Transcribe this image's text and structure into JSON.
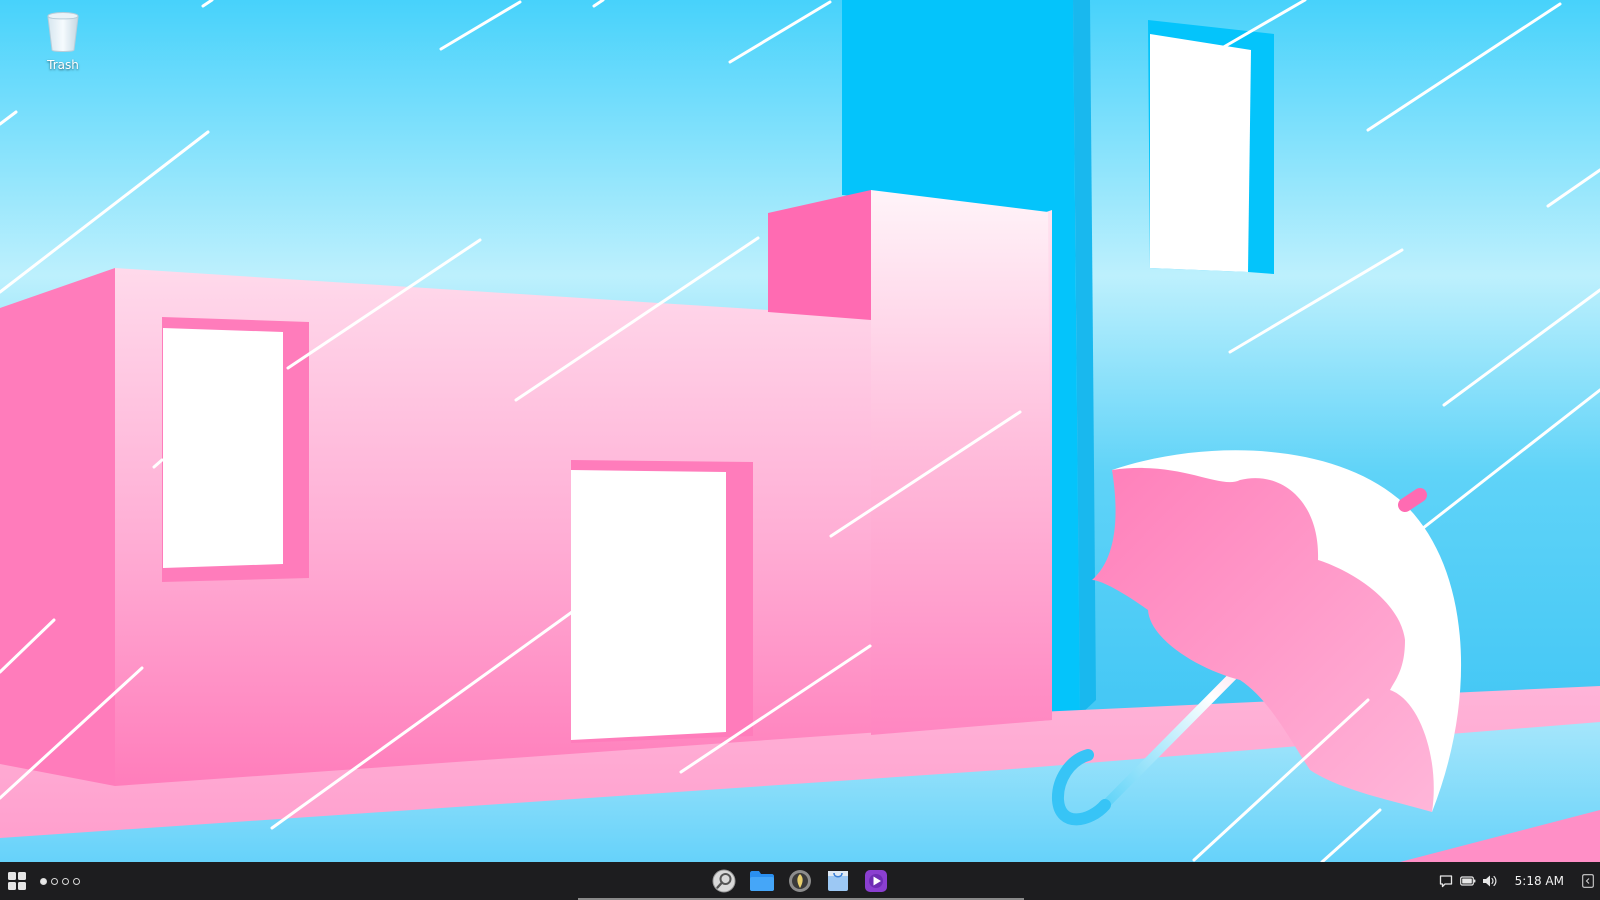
{
  "desktop": {
    "icons": [
      {
        "label": "Trash",
        "icon": "trash-icon"
      }
    ],
    "wallpaper": {
      "palette": {
        "sky": "#47d2fb",
        "building_pink": "#ff85c0",
        "building_light_pink": "#ffd8ea",
        "tower_blue": "#04c4fb",
        "window_white": "#ffffff"
      }
    }
  },
  "taskbar": {
    "launcher_icon": "grid-launcher-icon",
    "workspaces": {
      "count": 4,
      "active_index": 0
    },
    "dock_apps": [
      {
        "icon": "search-app-icon"
      },
      {
        "icon": "file-manager-icon"
      },
      {
        "icon": "media-app-icon"
      },
      {
        "icon": "store-app-icon"
      },
      {
        "icon": "video-player-icon"
      }
    ],
    "tray": {
      "icons": [
        "notification-icon",
        "battery-icon",
        "volume-icon"
      ],
      "clock": "5:18 AM",
      "show_desktop_icon": "show-desktop-icon"
    },
    "colors": {
      "background": "#1d1d1f",
      "text": "#f0f0f0"
    }
  }
}
